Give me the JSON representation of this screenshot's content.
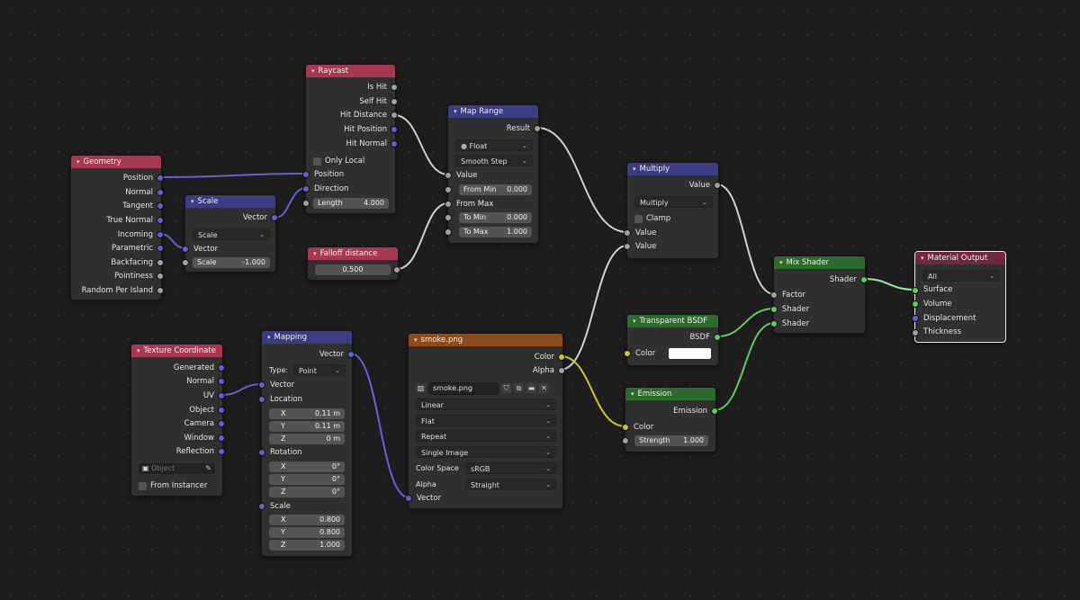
{
  "colors": {
    "header_input": "#a63850",
    "header_convert": "#3c3c83",
    "header_shader": "#2d6b2d",
    "header_texture": "#8f4a1b",
    "header_output": "#71273c",
    "socket_geometry": "#6363c7",
    "socket_float": "#a1a1a1",
    "socket_shader": "#63c763",
    "socket_color": "#c7c729"
  },
  "geometry": {
    "title": "Geometry",
    "outputs": [
      "Position",
      "Normal",
      "Tangent",
      "True Normal",
      "Incoming",
      "Parametric",
      "Backfacing",
      "Pointiness",
      "Random Per Island"
    ]
  },
  "scale": {
    "title": "Scale",
    "output": "Vector",
    "mode": "Scale",
    "input": "Vector",
    "scale_label": "Scale",
    "scale_value": "-1.000"
  },
  "raycast": {
    "title": "Raycast",
    "outputs": [
      "Is Hit",
      "Self Hit",
      "Hit Distance",
      "Hit Position",
      "Hit Normal"
    ],
    "only_local": "Only Local",
    "inputs": [
      "Position",
      "Direction"
    ],
    "length_label": "Length",
    "length_value": "4.000"
  },
  "falloff": {
    "title": "Falloff distance",
    "value": "0.500"
  },
  "map_range": {
    "title": "Map Range",
    "output": "Result",
    "data_type": "Float",
    "interpolation": "Smooth Step",
    "input_value": "Value",
    "from_min_label": "From Min",
    "from_min": "0.000",
    "from_max": "From Max",
    "to_min_label": "To Min",
    "to_min": "0.000",
    "to_max_label": "To Max",
    "to_max": "1.000"
  },
  "multiply": {
    "title": "Multiply",
    "output": "Value",
    "operation": "Multiply",
    "clamp": "Clamp",
    "inputs": [
      "Value",
      "Value"
    ]
  },
  "transparent": {
    "title": "Transparent BSDF",
    "output": "BSDF",
    "color_label": "Color"
  },
  "emission": {
    "title": "Emission",
    "output": "Emission",
    "color_label": "Color",
    "strength_label": "Strength",
    "strength": "1.000"
  },
  "mix_shader": {
    "title": "Mix Shader",
    "output": "Shader",
    "inputs": [
      "Factor",
      "Shader",
      "Shader"
    ]
  },
  "material_output": {
    "title": "Material Output",
    "target": "All",
    "inputs": [
      "Surface",
      "Volume",
      "Displacement",
      "Thickness"
    ]
  },
  "tex_coord": {
    "title": "Texture Coordinate",
    "outputs": [
      "Generated",
      "Normal",
      "UV",
      "Object",
      "Camera",
      "Window",
      "Reflection"
    ],
    "object_placeholder": "Object",
    "from_instancer": "From Instancer"
  },
  "mapping": {
    "title": "Mapping",
    "output": "Vector",
    "type_label": "Type:",
    "type_value": "Point",
    "vector": "Vector",
    "location": "Location",
    "rotation": "Rotation",
    "scale": "Scale",
    "axes": [
      "X",
      "Y",
      "Z"
    ],
    "location_values": [
      "0.11 m",
      "0.11 m",
      "0 m"
    ],
    "rotation_values": [
      "0°",
      "0°",
      "0°"
    ],
    "scale_values": [
      "0.800",
      "0.800",
      "1.000"
    ]
  },
  "image_tex": {
    "title": "smoke.png",
    "outputs": [
      "Color",
      "Alpha"
    ],
    "filename": "smoke.png",
    "interpolation": "Linear",
    "projection": "Flat",
    "extension": "Repeat",
    "source": "Single Image",
    "color_space_label": "Color Space",
    "color_space": "sRGB",
    "alpha_label": "Alpha",
    "alpha_mode": "Straight",
    "input": "Vector"
  }
}
